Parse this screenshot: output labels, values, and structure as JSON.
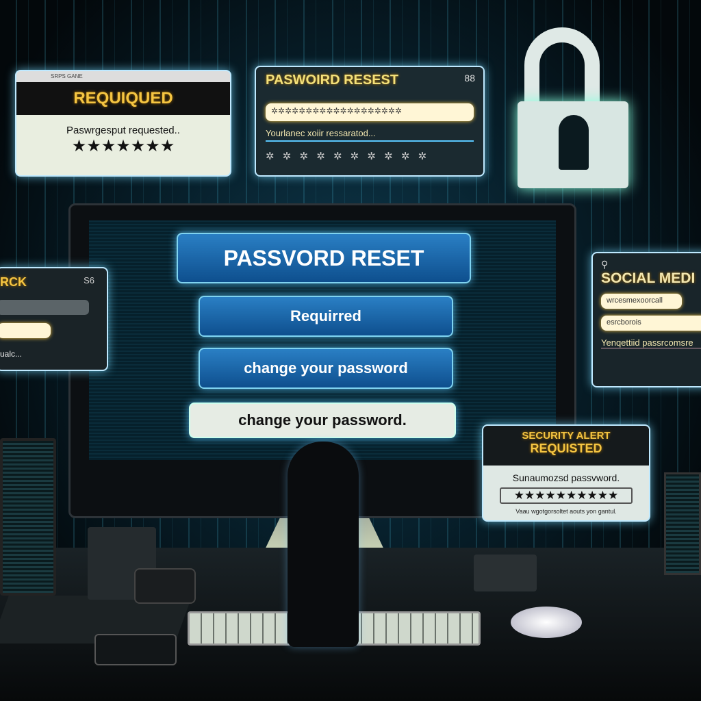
{
  "popup_required": {
    "titlebar": "SRPS GANE",
    "heading": "REQUIQUED",
    "message": "Paswrgesput requested..",
    "stars": "★★★★★★★"
  },
  "popup_reset_top": {
    "heading": "PASWOIRD RESEST",
    "badge": "88",
    "field": "✲✲✲✲✲✲✲✲✲✲✲✲✲✲✲✲✲✲✲",
    "message": "Yourlanec xoiir ressaratod...",
    "dots": "✲ ✲ ✲ ✲ ✲ ✲ ✲ ✲ ✲ ✲"
  },
  "popup_left": {
    "heading": "RCK",
    "badge": "S6",
    "message": "ualc..."
  },
  "main_screen": {
    "title": "PASSVORD RESET",
    "required_button": "Requirred",
    "change_button": "change your password",
    "change_bar": "change your password."
  },
  "social_popup": {
    "heading": "SOCIAL MEDI",
    "field1": "wrcesmexoorcall",
    "field2": "esrcborois",
    "message": "Yenqettiid passrcomsre"
  },
  "security_popup": {
    "heading": "SECURITY ALERT",
    "subheading": "REQUISTED",
    "message": "Sunaumozsd passvword.",
    "stars": "★★★★★★★★★★",
    "footer": "Vaau wgotgorsoltet aouts yon gantul."
  },
  "colors": {
    "accent": "#f5c542",
    "glow": "#5ac8ff",
    "button": "#1a66ad"
  }
}
